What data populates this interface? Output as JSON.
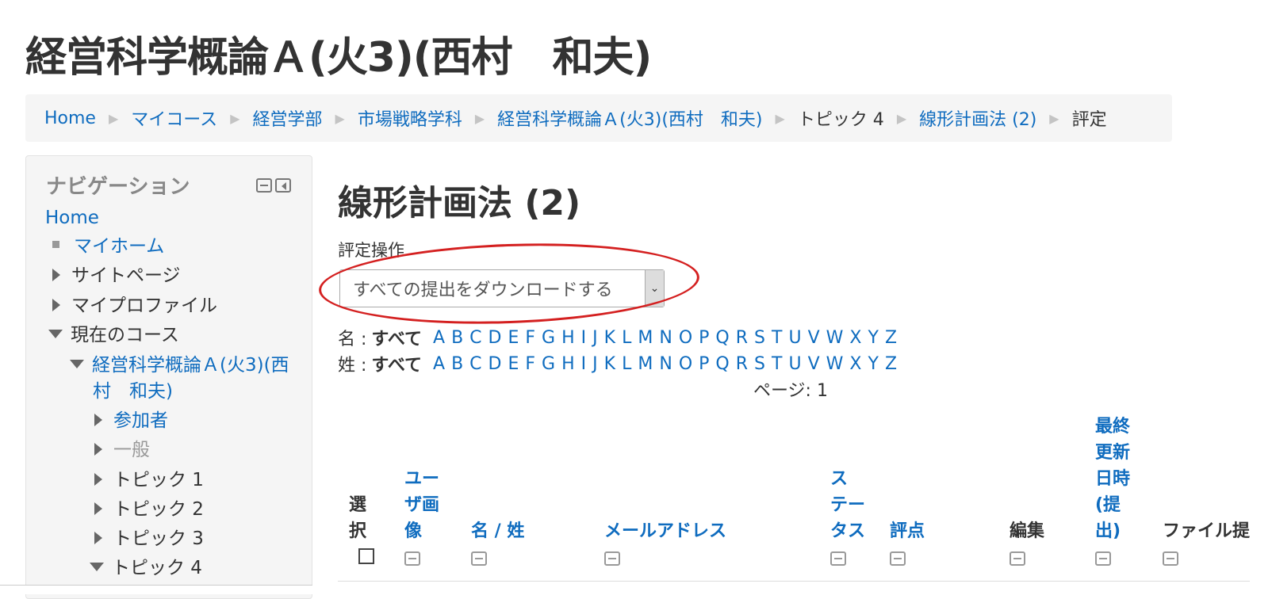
{
  "page": {
    "title": "経営科学概論Ａ(火3)(西村　和夫)"
  },
  "breadcrumb": [
    {
      "label": "Home",
      "link": true
    },
    {
      "label": "マイコース",
      "link": true
    },
    {
      "label": "経営学部",
      "link": true
    },
    {
      "label": "市場戦略学科",
      "link": true
    },
    {
      "label": "経営科学概論Ａ(火3)(西村　和夫)",
      "link": true
    },
    {
      "label": "トピック 4",
      "link": false
    },
    {
      "label": "線形計画法 (2)",
      "link": true
    },
    {
      "label": "評定",
      "link": false
    }
  ],
  "breadcrumb_separator": "▶",
  "navigation": {
    "title": "ナビゲーション",
    "items": [
      {
        "label": "Home"
      },
      {
        "label": "マイホーム"
      },
      {
        "label": "サイトページ"
      },
      {
        "label": "マイプロファイル"
      },
      {
        "label": "現在のコース"
      },
      {
        "label": "経営科学概論Ａ(火3)(西"
      },
      {
        "label": "村　和夫)"
      },
      {
        "label": "参加者"
      },
      {
        "label": "一般"
      },
      {
        "label": "トピック 1"
      },
      {
        "label": "トピック 2"
      },
      {
        "label": "トピック 3"
      },
      {
        "label": "トピック 4"
      }
    ]
  },
  "assignment": {
    "title": "線形計画法 (2)",
    "ops_label": "評定操作",
    "selected_op": "すべての提出をダウンロードする",
    "select_arrow": "⌄"
  },
  "filters": {
    "first_label": "名 :",
    "last_label": "姓 :",
    "all_label": "すべて",
    "letters": [
      "A",
      "B",
      "C",
      "D",
      "E",
      "F",
      "G",
      "H",
      "I",
      "J",
      "K",
      "L",
      "M",
      "N",
      "O",
      "P",
      "Q",
      "R",
      "S",
      "T",
      "U",
      "V",
      "W",
      "X",
      "Y",
      "Z"
    ]
  },
  "paging": {
    "text": "ページ:  1"
  },
  "table": {
    "headers": {
      "select_1": "選",
      "select_2": "択",
      "user_image_1": "ユー",
      "user_image_2": "ザ画",
      "user_image_3": "像",
      "name": "名 / 姓",
      "email": "メールアドレス",
      "status_1": "ス",
      "status_2": "テー",
      "status_3": "タス",
      "grade": "評点",
      "edit": "編集",
      "modified_1": "最終",
      "modified_2": "更新",
      "modified_3": "日時",
      "modified_4": "(提",
      "modified_5": "出)",
      "files": "ファイル提"
    }
  },
  "colors": {
    "link": "#0f6cbf",
    "annotation": "#d42020",
    "breadcrumb_bg": "#f5f5f5"
  }
}
